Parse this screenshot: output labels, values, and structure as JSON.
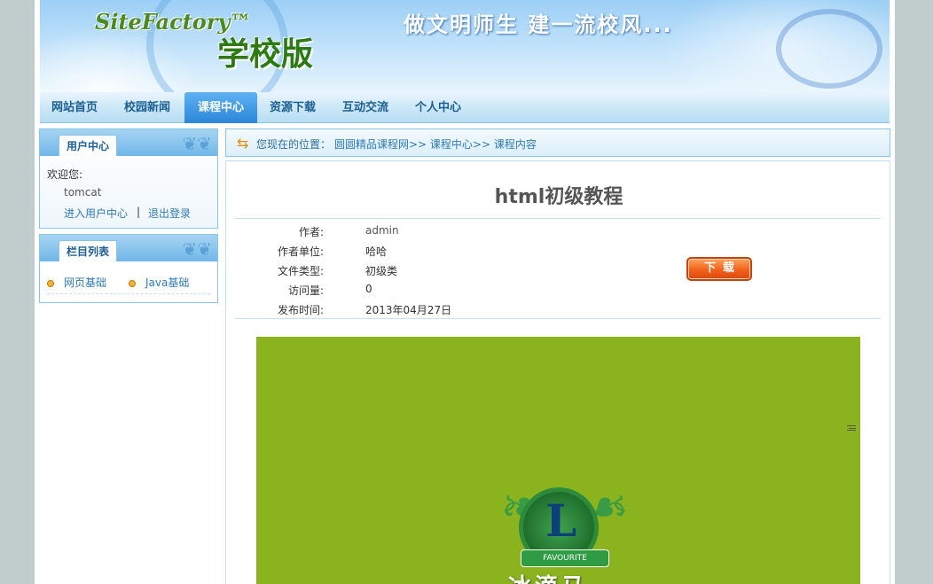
{
  "header": {
    "brand": "SiteFactory™",
    "edition": "学校版",
    "slogan": "做文明师生  建一流校风..."
  },
  "nav": {
    "items": [
      {
        "label": "网站首页",
        "active": false
      },
      {
        "label": "校园新闻",
        "active": false
      },
      {
        "label": "课程中心",
        "active": true
      },
      {
        "label": "资源下载",
        "active": false
      },
      {
        "label": "互动交流",
        "active": false
      },
      {
        "label": "个人中心",
        "active": false
      }
    ]
  },
  "user_panel": {
    "title": "用户中心",
    "welcome": "欢迎您:",
    "username": "tomcat",
    "enter_link": "进入用户中心",
    "separator": "|",
    "logout_link": "退出登录"
  },
  "column_panel": {
    "title": "栏目列表",
    "items": [
      "网页基础",
      "Java基础"
    ]
  },
  "breadcrumb": {
    "prefix": "您现在的位置：",
    "path": "圆圆精品课程网>> 课程中心>> 课程内容"
  },
  "course": {
    "title": "html初级教程",
    "fields": [
      {
        "label": "作者:",
        "value": "admin"
      },
      {
        "label": "作者单位:",
        "value": "哈哈"
      },
      {
        "label": "文件类型:",
        "value": "初级类"
      },
      {
        "label": "访问量:",
        "value": "0"
      },
      {
        "label": "发布时间:",
        "value": "2013年04月27日"
      }
    ],
    "download_label": "下载"
  },
  "preview": {
    "ribbon_text": "FAVOURITE",
    "school_name": "冰滴马"
  },
  "colors": {
    "accent": "#2b86d9",
    "preview_bg": "#8ab31e",
    "download": "#f2611a"
  }
}
